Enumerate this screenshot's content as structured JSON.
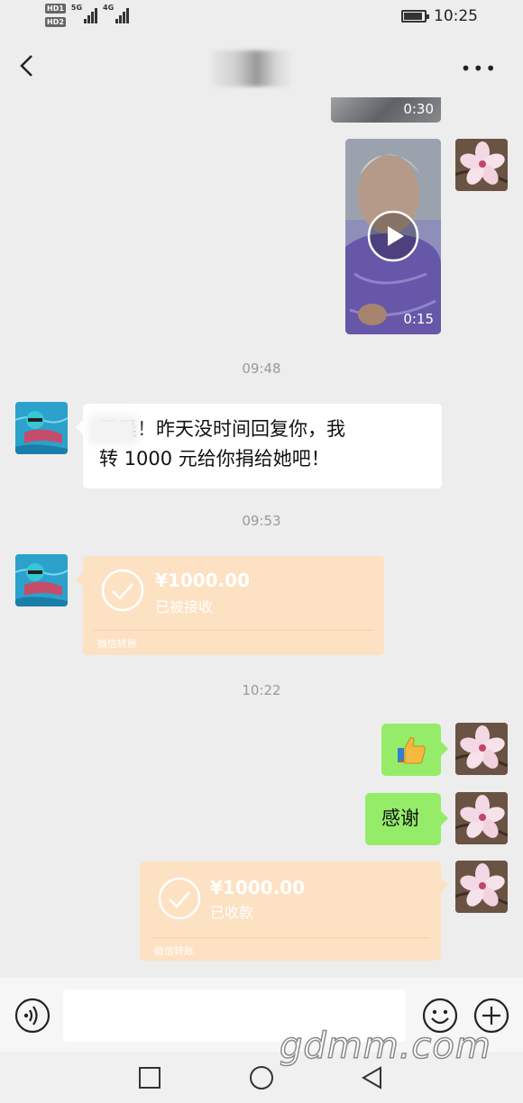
{
  "status_bar": {
    "sim1": "HD1",
    "sim2": "HD2",
    "network1": "5G",
    "network2": "4G",
    "time": "10:25"
  },
  "header": {
    "contact_name_blurred": "",
    "back_icon": "chevron-left-icon",
    "more_icon": "more-dots-icon"
  },
  "messages": {
    "video_prev_duration": "0:30",
    "video_duration": "0:15",
    "time1": "09:48",
    "text_message": "早晨！昨天没时间回复你，我转 1000 元给你捐给她吧！",
    "text_message_line1": "早晨！昨天没时间回复你，我",
    "text_message_line2": "转 1000 元给你捐给她吧！",
    "time2": "09:53",
    "transfer_in": {
      "amount": "¥1000.00",
      "status": "已被接收",
      "footer": "微信转账"
    },
    "time3": "10:22",
    "thumbs_icon": "thumbs-up-icon",
    "thanks": "感谢",
    "transfer_out": {
      "amount": "¥1000.00",
      "status": "已收款",
      "footer": "微信转账"
    }
  },
  "input_bar": {
    "placeholder": "",
    "voice_icon": "voice-icon",
    "emoji_icon": "emoji-icon",
    "plus_icon": "plus-icon"
  },
  "watermark": "gdmm.com",
  "colors": {
    "background": "#ededed",
    "green_bubble": "#95ec69",
    "transfer_bg": "#fde1c3"
  }
}
